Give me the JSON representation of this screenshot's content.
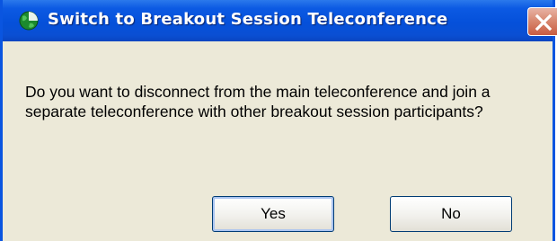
{
  "dialog": {
    "title": "Switch to Breakout Session Teleconference",
    "message_lines": [
      "Do you want to disconnect from the main teleconference and join a",
      "separate teleconference with other breakout session participants?"
    ],
    "buttons": {
      "yes_label": "Yes",
      "no_label": "No"
    }
  },
  "icons": {
    "app": "globe-icon",
    "close": "close-icon"
  },
  "colors": {
    "titlebar": "#0550da",
    "dialog_bg": "#ece9d8",
    "close_button": "#d98a72"
  }
}
